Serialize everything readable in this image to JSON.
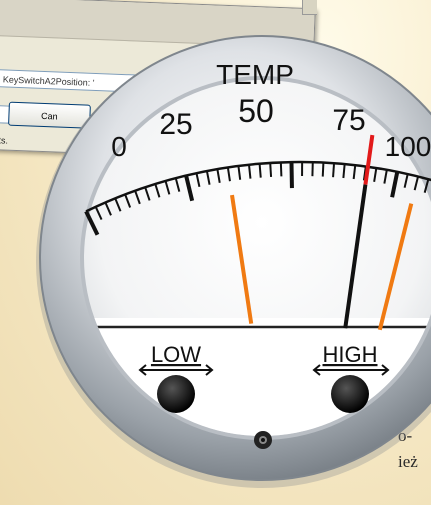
{
  "dialog": {
    "field_value": "KeySwitchA2Position: '",
    "cancel_label": "Can",
    "status_text": "nts."
  },
  "gauge": {
    "label": "TEMP",
    "scale_labels": [
      "0",
      "25",
      "50",
      "75",
      "100"
    ],
    "low_label": "LOW",
    "high_label": "HIGH",
    "needle_value": 68,
    "low_marker_value": 35,
    "high_marker_value": 80,
    "colors": {
      "needle_tip": "#e21a1a",
      "needle_body": "#111111",
      "markers": "#f07a12",
      "bezel": "#c9cdd2",
      "face": "#ffffff"
    }
  },
  "page_text": {
    "line1": "o-",
    "line2": "ież"
  }
}
